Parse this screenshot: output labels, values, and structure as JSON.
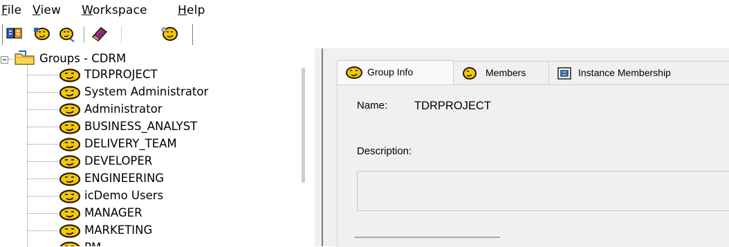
{
  "menu": {
    "file": {
      "mn": "F",
      "rest": "ile"
    },
    "view": {
      "mn": "V",
      "rest": "iew"
    },
    "workspace": {
      "mn": "W",
      "rest": "orkspace"
    },
    "help": {
      "mn": "H",
      "rest": "elp"
    }
  },
  "toolbar": {
    "icons": [
      "group-scan-icon",
      "group-add-icon",
      "group-edit-icon",
      "book-icon",
      "group-properties-icon"
    ]
  },
  "tree": {
    "root_label": "Groups - CDRM",
    "items": [
      {
        "label": "TDRPROJECT"
      },
      {
        "label": "System Administrator"
      },
      {
        "label": "Administrator"
      },
      {
        "label": "BUSINESS_ANALYST"
      },
      {
        "label": "DELIVERY_TEAM"
      },
      {
        "label": "DEVELOPER"
      },
      {
        "label": "ENGINEERING"
      },
      {
        "label": "icDemo Users"
      },
      {
        "label": "MANAGER"
      },
      {
        "label": "MARKETING"
      },
      {
        "label": "PM"
      }
    ]
  },
  "tabs": [
    {
      "label": "Group Info",
      "active": true
    },
    {
      "label": "Members",
      "active": false
    },
    {
      "label": "Instance Membership",
      "active": false
    }
  ],
  "group_info": {
    "name_label": "Name:",
    "name_value": "TDRPROJECT",
    "description_label": "Description:",
    "description_value": ""
  },
  "colors": {
    "group_icon_yellow": "#f2c80f",
    "group_icon_outline": "#2a1a00",
    "folder_yellow": "#f7d658",
    "book_purple": "#7b2c8f"
  }
}
